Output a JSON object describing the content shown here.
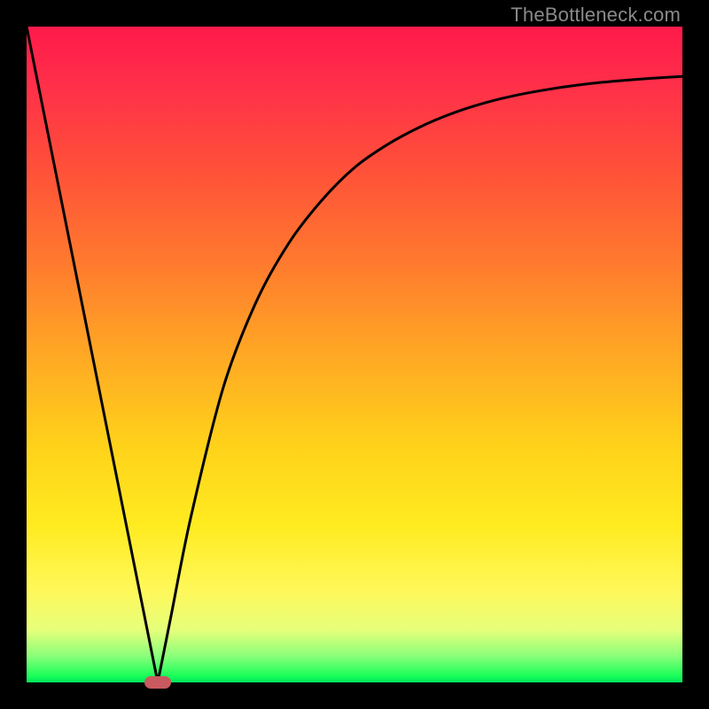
{
  "watermark": "TheBottleneck.com",
  "colors": {
    "background": "#000000",
    "gradient_top": "#ff1a4b",
    "gradient_bottom": "#00e65a",
    "curve": "#000000",
    "marker": "#c85a5f",
    "watermark": "#8a8a8a"
  },
  "chart_data": {
    "type": "line",
    "title": "",
    "xlabel": "",
    "ylabel": "",
    "xlim": [
      0,
      100
    ],
    "ylim": [
      0,
      100
    ],
    "grid": false,
    "legend": false,
    "x": [
      0,
      5,
      10,
      15,
      18,
      20,
      22,
      25,
      30,
      35,
      40,
      45,
      50,
      55,
      60,
      65,
      70,
      75,
      80,
      85,
      90,
      95,
      100
    ],
    "values": [
      100,
      75,
      50,
      25,
      10,
      0,
      10,
      25,
      45,
      58,
      67,
      73.5,
      78.5,
      82,
      84.7,
      86.8,
      88.4,
      89.6,
      90.5,
      91.2,
      91.7,
      92.1,
      92.4
    ],
    "marker": {
      "x": 20,
      "y": 0
    },
    "notes": "Values are percentages read off the vertical gradient scale (0 at bottom/green, 100 at top/red). Curve left branch is roughly linear from (0,100) to a minimum at x≈20; right branch rises sharply then decelerates toward an asymptote near y≈92."
  }
}
